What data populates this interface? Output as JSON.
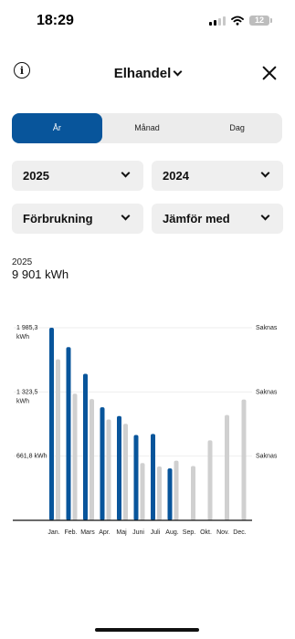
{
  "status_bar": {
    "time": "18:29",
    "battery": "12"
  },
  "header": {
    "title": "Elhandel",
    "info_icon": "info-icon",
    "close_icon": "close-icon",
    "title_chevron_icon": "chevron-down-icon"
  },
  "tabs": [
    {
      "label": "År",
      "active": true
    },
    {
      "label": "Månad",
      "active": false
    },
    {
      "label": "Dag",
      "active": false
    }
  ],
  "filters": {
    "year": "2025",
    "compare_year": "2024",
    "metric": "Förbrukning",
    "compare": "Jämför med"
  },
  "summary": {
    "year": "2025",
    "total": "9 901 kWh"
  },
  "colors": {
    "primary": "#08559b",
    "comparison": "#d0d0d0",
    "tab_background": "#ececec",
    "dropdown_background": "#efefef"
  },
  "chart_data": {
    "type": "bar",
    "categories": [
      "Jan.",
      "Feb.",
      "Mars",
      "Apr.",
      "Maj",
      "Juni",
      "Juli",
      "Aug.",
      "Sep.",
      "Okt.",
      "Nov.",
      "Dec."
    ],
    "series": [
      {
        "name": "2025",
        "color": "#08559b",
        "values": [
          1985.3,
          1785,
          1510,
          1165,
          1075,
          880,
          890,
          535,
          null,
          null,
          null,
          null
        ]
      },
      {
        "name": "2024",
        "color": "#d0d0d0",
        "values": [
          1660,
          1305,
          1250,
          1040,
          995,
          590,
          555,
          615,
          560,
          825,
          1085,
          1245
        ]
      }
    ],
    "y_ticks": [
      {
        "value": 1985.3,
        "label": "1 985,3",
        "unit": "kWh",
        "right_label": "Saknas"
      },
      {
        "value": 1323.5,
        "label": "1 323,5",
        "unit": "kWh",
        "right_label": "Saknas"
      },
      {
        "value": 661.8,
        "label": "661,8 kWh",
        "unit": "",
        "right_label": "Saknas"
      }
    ],
    "ylim": [
      0,
      2000
    ],
    "grid": true,
    "legend": "none"
  }
}
